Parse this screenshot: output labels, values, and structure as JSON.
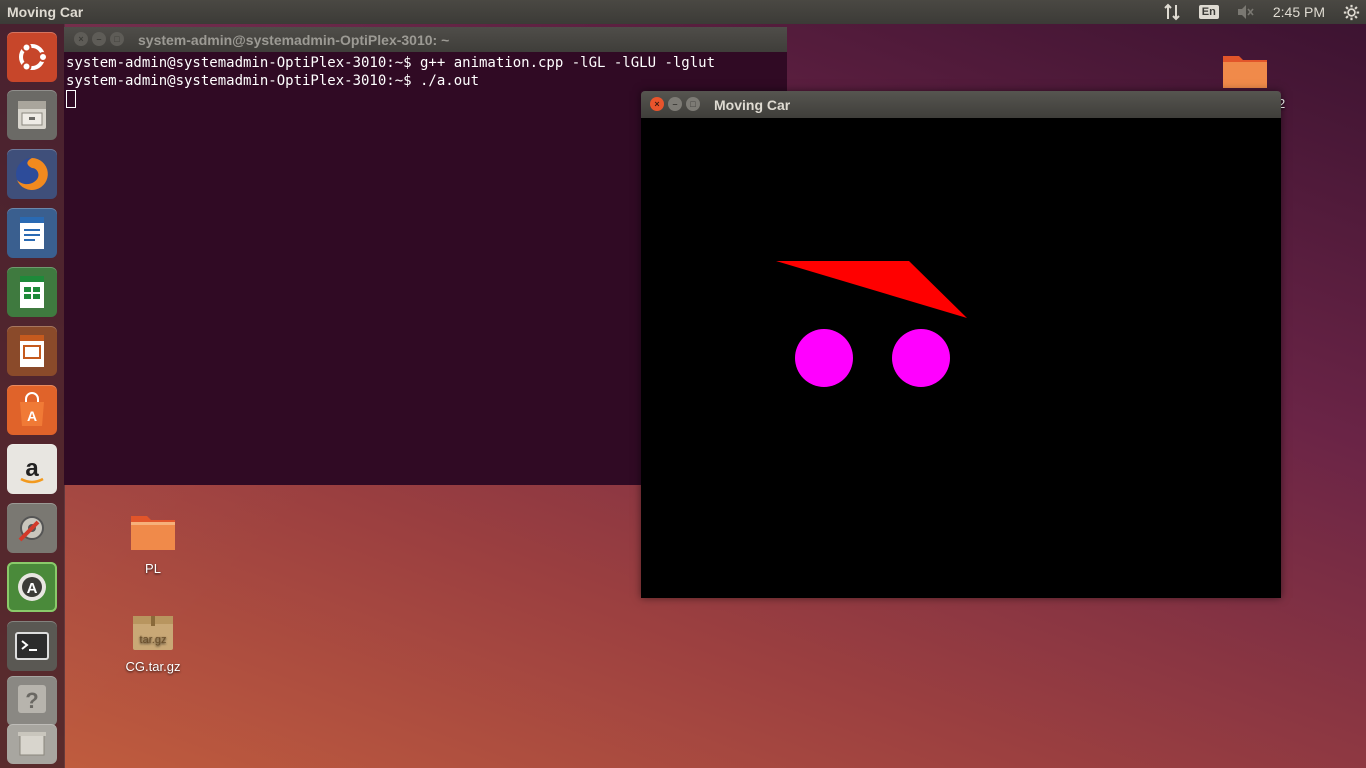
{
  "top_panel": {
    "title": "Moving Car",
    "language": "En",
    "time": "2:45 PM",
    "icons": [
      "network-arrows-icon",
      "volume-muted-icon",
      "settings-gear-icon"
    ]
  },
  "launcher": {
    "items": [
      {
        "name": "ubuntu-dash",
        "icon": "ubuntu-logo-icon"
      },
      {
        "name": "files",
        "icon": "file-cabinet-icon"
      },
      {
        "name": "firefox",
        "icon": "firefox-icon"
      },
      {
        "name": "libreoffice-writer",
        "icon": "writer-icon"
      },
      {
        "name": "libreoffice-calc",
        "icon": "calc-icon"
      },
      {
        "name": "libreoffice-impress",
        "icon": "impress-icon"
      },
      {
        "name": "software-center",
        "icon": "shopping-bag-icon"
      },
      {
        "name": "amazon",
        "icon": "amazon-icon"
      },
      {
        "name": "system-settings",
        "icon": "settings-wrench-icon"
      },
      {
        "name": "software-updater",
        "icon": "updater-icon"
      },
      {
        "name": "terminal",
        "icon": "terminal-icon"
      },
      {
        "name": "help",
        "icon": "help-icon"
      },
      {
        "name": "trash",
        "icon": "trash-icon"
      }
    ]
  },
  "terminal": {
    "title": "system-admin@systemadmin-OptiPlex-3010: ~",
    "lines": [
      "system-admin@systemadmin-OptiPlex-3010:~$ g++ animation.cpp -lGL -lGLU -lglut",
      "system-admin@systemadmin-OptiPlex-3010:~$ ./a.out"
    ]
  },
  "car_window": {
    "title": "Moving Car",
    "colors": {
      "body": "#ff0000",
      "wheels": "#ff00ff",
      "background": "#000000"
    }
  },
  "desktop": {
    "icons": [
      {
        "label": "PL",
        "type": "folder"
      },
      {
        "label": "CG.tar.gz",
        "type": "archive",
        "badge": "tar.gz"
      },
      {
        "label": "2",
        "type": "folder"
      }
    ]
  }
}
